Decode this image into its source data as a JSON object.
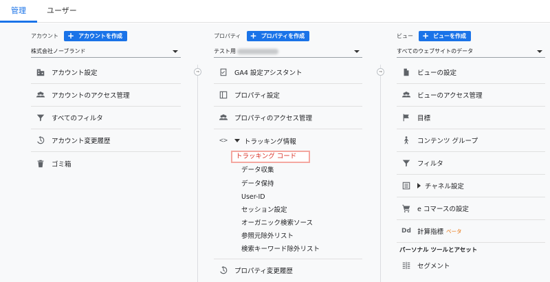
{
  "tabs": [
    "管理",
    "ユーザー"
  ],
  "account": {
    "label": "アカウント",
    "create_label": "アカウントを作成",
    "selected": "株式会社ノーブランド",
    "items": [
      "アカウント設定",
      "アカウントのアクセス管理",
      "すべてのフィルタ",
      "アカウント変更履歴",
      "ゴミ箱"
    ]
  },
  "property": {
    "label": "プロパティ",
    "create_label": "プロパティを作成",
    "selected": "テスト用",
    "items": [
      "GA4 設定アシスタント",
      "プロパティ設定",
      "プロパティのアクセス管理"
    ],
    "tracking_label": "トラッキング情報",
    "tracking_sub": [
      "トラッキング コード",
      "データ収集",
      "データ保持",
      "User-ID",
      "セッション設定",
      "オーガニック検索ソース",
      "参照元除外リスト",
      "検索キーワード除外リスト"
    ],
    "history_label": "プロパティ変更履歴"
  },
  "view": {
    "label": "ビュー",
    "create_label": "ビューを作成",
    "selected": "すべてのウェブサイトのデータ",
    "items": [
      "ビューの設定",
      "ビューのアクセス管理",
      "目標",
      "コンテンツ グループ",
      "フィルタ",
      "チャネル設定",
      "e コマースの設定",
      "計算指標"
    ],
    "beta": "ベータ",
    "section": "パーソナル ツールとアセット",
    "segment": "セグメント"
  },
  "colors": {
    "accent": "#1a73e8",
    "highlight_border": "#f4a7a0",
    "highlight_text": "#d93025",
    "beta": "#e8710a"
  }
}
